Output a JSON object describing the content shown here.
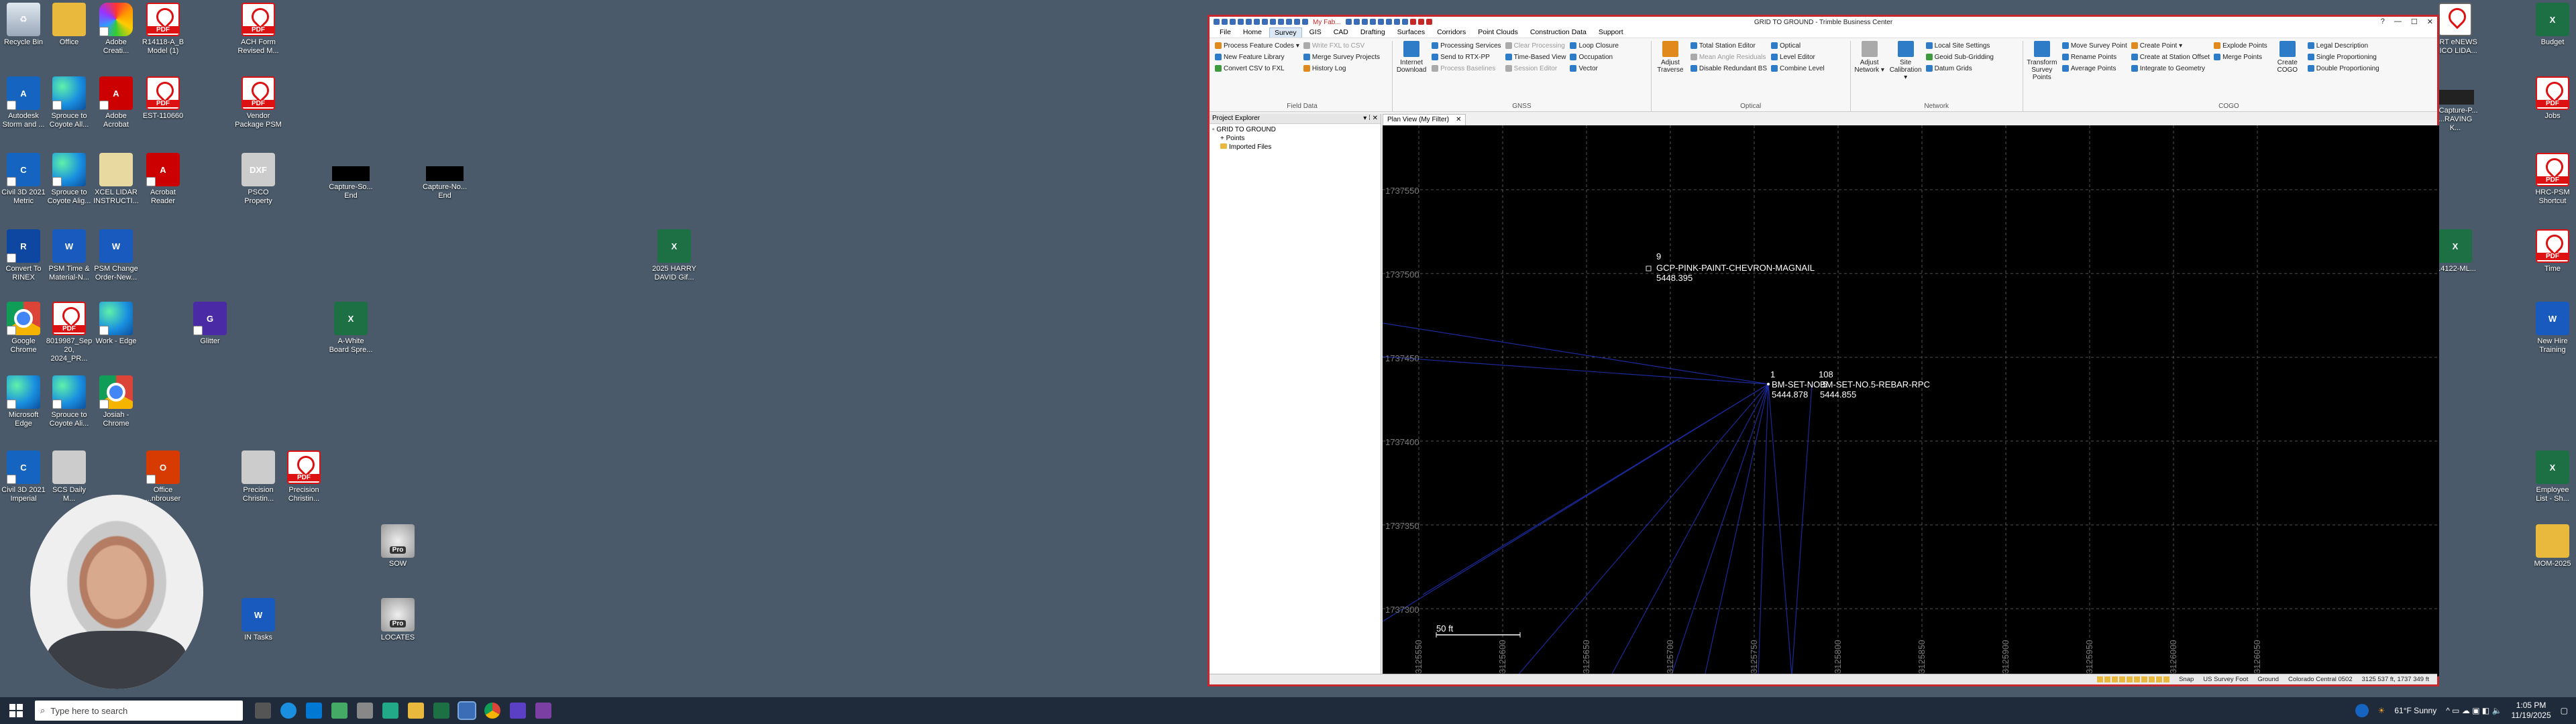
{
  "desktop": {
    "icons": [
      {
        "label": "Recycle Bin"
      },
      {
        "label": "Office"
      },
      {
        "label": "Adobe\nCreati..."
      },
      {
        "label": "R14118-A_B\nModel (1)"
      },
      {
        "label": "ACH Form\nRevised M..."
      },
      {
        "label": "Autodesk\nStorm and ..."
      },
      {
        "label": "Sprouce to\nCoyote All..."
      },
      {
        "label": "Adobe\nAcrobat"
      },
      {
        "label": "EST-110660"
      },
      {
        "label": "Vendor\nPackage PSM"
      },
      {
        "label": "Civil 3D 2021\nMetric"
      },
      {
        "label": "Sprouce to\nCoyote Alig..."
      },
      {
        "label": "XCEL LIDAR\nINSTRUCTI..."
      },
      {
        "label": "Acrobat\nReader"
      },
      {
        "label": "PSCO\nProperty"
      },
      {
        "label": "Capture-So...\nEnd"
      },
      {
        "label": "Capture-No...\nEnd"
      },
      {
        "label": "Convert To\nRINEX"
      },
      {
        "label": "PSM Time &\nMaterial-N..."
      },
      {
        "label": "PSM Change\nOrder-New..."
      },
      {
        "label": "2025 HARRY\nDAVID Gif..."
      },
      {
        "label": "Google\nChrome"
      },
      {
        "label": "8019987_Sep\n20, 2024_PR..."
      },
      {
        "label": "Work - Edge"
      },
      {
        "label": "Glitter"
      },
      {
        "label": "A-White\nBoard Spre..."
      },
      {
        "label": "Microsoft\nEdge"
      },
      {
        "label": "Sprouce to\nCoyote Ali..."
      },
      {
        "label": "Josiah -\nChrome"
      },
      {
        "label": "Civil 3D 2021\nImperial"
      },
      {
        "label": "SCS Daily\nM..."
      },
      {
        "label": "Office\n...nbrouser"
      },
      {
        "label": "Precision\nChristin..."
      },
      {
        "label": "Precision\nChristin..."
      },
      {
        "label": "SOW"
      },
      {
        "label": "IN Tasks"
      },
      {
        "label": "LOCATES"
      },
      {
        "label": "...RT eNEWS\n...ICO LIDA..."
      },
      {
        "label": "Budget"
      },
      {
        "label": "...Capture-P...\n...RAVING K..."
      },
      {
        "label": "Jobs"
      },
      {
        "label": "HRC-PSM\nShortcut"
      },
      {
        "label": "...4122-ML..."
      },
      {
        "label": "Time"
      },
      {
        "label": "New Hire\nTraining"
      },
      {
        "label": "Employee\nList - Sh..."
      },
      {
        "label": "MOM-2025"
      }
    ]
  },
  "window": {
    "title": "GRID TO GROUND - Trimble Business Center",
    "qat_label": "My Fab...",
    "controls": [
      "?",
      "—",
      "☐",
      "✕"
    ],
    "menu_tabs": [
      "File",
      "Home",
      "Survey",
      "GIS",
      "CAD",
      "Drafting",
      "Surfaces",
      "Corridors",
      "Point Clouds",
      "Construction Data",
      "Support"
    ],
    "active_tab": "Survey",
    "ribbon": {
      "field_data": {
        "name": "Field Data",
        "items": [
          "Process Feature Codes ▾",
          "New Feature Library",
          "Convert CSV to FXL",
          "Write FXL to CSV",
          "Merge Survey Projects",
          "History Log"
        ]
      },
      "gnss": {
        "name": "GNSS",
        "big": "Internet Download",
        "items": [
          "Processing Services",
          "Send to RTX-PP",
          "Process Baselines",
          "Clear Processing",
          "Time-Based View",
          "Session Editor",
          "Loop Closure",
          "Occupation",
          "Vector"
        ]
      },
      "optical": {
        "name": "Optical",
        "big": "Adjust Traverse",
        "items": [
          "Total Station Editor",
          "Mean Angle Residuals",
          "Disable Redundant BS",
          "Optical",
          "Level Editor",
          "Combine Level"
        ]
      },
      "network": {
        "name": "Network",
        "big1": "Adjust Network ▾",
        "big2": "Site Calibration ▾",
        "items": [
          "Local Site Settings",
          "Geoid Sub-Gridding",
          "Datum Grids"
        ]
      },
      "cogo": {
        "name": "COGO",
        "big1": "Transform Survey Points",
        "big2": "Create COGO",
        "items": [
          "Move Survey Point",
          "Rename Points",
          "Average Points",
          "Create Point ▾",
          "Create at Station Offset",
          "Integrate to Geometry",
          "Explode Points",
          "Merge Points",
          "Legal Description",
          "Single Proportioning",
          "Double Proportioning"
        ]
      }
    },
    "project_explorer": {
      "title": "Project Explorer",
      "pin": "▾ ⁞ ✕",
      "root": "GRID TO GROUND",
      "children": [
        "Points",
        "Imported Files"
      ]
    },
    "view_tab": {
      "label": "Plan View (My Filter)",
      "close": "✕"
    },
    "plan": {
      "y_ticks": [
        "1737550",
        "1737500",
        "1737450",
        "1737400",
        "1737350",
        "1737300"
      ],
      "x_ticks": [
        "3125550",
        "3125600",
        "3125650",
        "3125700",
        "3125750",
        "3125800",
        "3125850",
        "3125900",
        "3125950",
        "3126000",
        "3126050"
      ],
      "points": [
        {
          "num": "9",
          "desc": "GCP-PINK-PAINT-CHEVRON-MAGNAIL",
          "elev": "5448.395"
        },
        {
          "num": "1",
          "desc": "BM-SET-NO.5",
          "elev": "5444.878"
        },
        {
          "num": "108",
          "desc": "BM-SET-NO.5-REBAR-RPC",
          "elev": "5444.855"
        }
      ],
      "scale_label": "50 ft"
    },
    "status": {
      "snap": "Snap",
      "units": "US Survey Foot",
      "mode": "Ground",
      "zone": "Colorado Central 0502",
      "coords": "3125 537 ft, 1737 349 ft"
    }
  },
  "taskbar": {
    "search_placeholder": "Type here to search",
    "weather": "61°F  Sunny",
    "time": "1:05 PM",
    "date": "11/19/2025"
  }
}
